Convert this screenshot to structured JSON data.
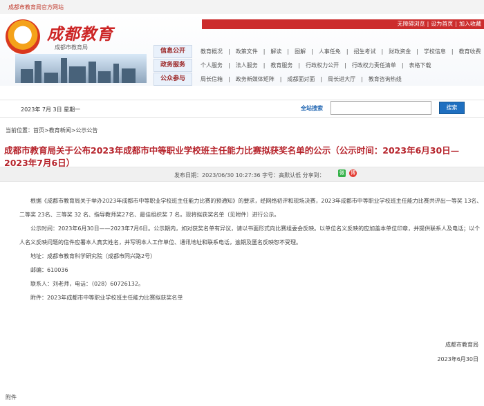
{
  "top": {
    "site": "成都市教育局官方网站"
  },
  "header": {
    "title": "成都教育",
    "subtitle": "成都市教育局",
    "links": [
      "无障碍浏览",
      "|",
      "设为首页",
      "|",
      "加入收藏"
    ]
  },
  "nav": [
    {
      "label": "信息公开",
      "items": [
        "教育概况",
        "|",
        "政策文件",
        "|",
        "解读",
        "|",
        "图解",
        "|",
        "人事任免",
        "|",
        "招生考试",
        "|",
        "财政资金",
        "|",
        "学校信息",
        "|",
        "教育收费"
      ]
    },
    {
      "label": "政务服务",
      "items": [
        "个人服务",
        "|",
        "法人服务",
        "|",
        "教育服务",
        "|",
        "行政权力公开",
        "|",
        "行政权力责任清单",
        "|",
        "表格下载"
      ]
    },
    {
      "label": "公众参与",
      "items": [
        "局长信箱",
        "|",
        "政务新媒体矩阵",
        "|",
        "成都面对面",
        "|",
        "局长进大厅",
        "|",
        "教育咨询热线"
      ]
    }
  ],
  "datebar": {
    "date": "2023年 7月 3日 星期一",
    "search_label": "全站搜索",
    "search_placeholder": "",
    "search_button": "搜索"
  },
  "breadcrumb": [
    "当前位置：",
    "首页",
    ">",
    "教育新闻",
    ">",
    "公示公告"
  ],
  "article": {
    "title": "成都市教育局关于公布2023年成都市中等职业学校班主任能力比赛拟获奖名单的公示（公示时间：2023年6月30日—2023年7月6日）",
    "publish": "发布日期：2023/06/30 10:27:36  字号：高默认低  分享到：",
    "paragraphs": [
      "根据《成都市教育局关于举办2023年成都市中等职业学校班主任能力比赛的预通知》的要求，经网络初评和现场决赛，2023年成都市中等职业学校班主任能力比赛共评出一等奖 13名、二等奖 23名、三等奖 32 名、指导教师奖27名、最佳组织奖 7 名。现将拟获奖名单（见附件）进行公示。",
      "公示时间：2023年6月30日——2023年7月6日。公示期内，如对获奖名单有异议，请以书面形式向比赛组委会反映。以单位名义反映的应加盖本单位印章，并提供联系人及电话；以个人名义反映问题的信件应署本人真实姓名，并写明本人工作单位、通讯地址和联系电话，逾期及匿名反映恕不受理。",
      "地址：成都市教育科学研究院（成都市同兴路2号）",
      "邮编：610036",
      "联系人：刘老师，电话：（028）60726132。",
      "附件：2023年成都市中等职业学校班主任能力比赛拟获奖名单"
    ],
    "signature": "成都市教育局",
    "date": "2023年6月30日",
    "attachment": "附件"
  }
}
